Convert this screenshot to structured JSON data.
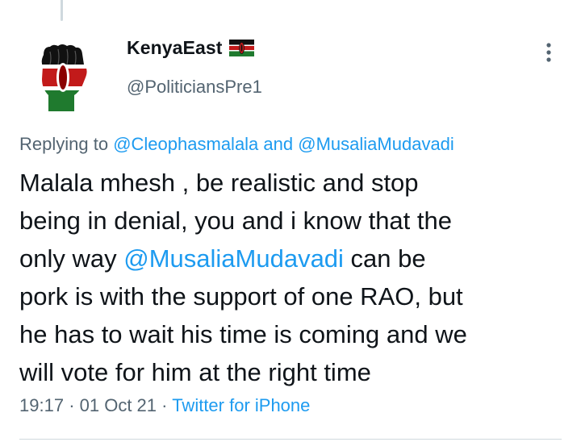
{
  "author": {
    "display_name": "KenyaEast",
    "handle": "@PoliticiansPre1",
    "flag_icon": "kenya-flag-icon",
    "avatar_icon": "raised-fist-kenya-flag-icon"
  },
  "reply": {
    "prefix": "Replying to",
    "mention_1": "@Cleophasmalala",
    "conjunction": "and",
    "mention_2": "@MusaliaMudavadi"
  },
  "tweet": {
    "line_1": "Malala mhesh , be realistic and stop",
    "line_2": "being in denial, you and i know that  the",
    "line_3_before": "only way ",
    "line_3_mention": "@MusaliaMudavadi",
    "line_3_after": " can be",
    "line_4": "pork is with the support of one RAO, but",
    "line_5": "he has to wait his time is coming and we",
    "line_6": "will vote for him at the right time"
  },
  "meta": {
    "time": "19:17",
    "separator": "·",
    "date": "01 Oct 21",
    "source": "Twitter for iPhone"
  },
  "colors": {
    "link": "#1d9bf0",
    "secondary_text": "#536471",
    "primary_text": "#0f1419"
  }
}
